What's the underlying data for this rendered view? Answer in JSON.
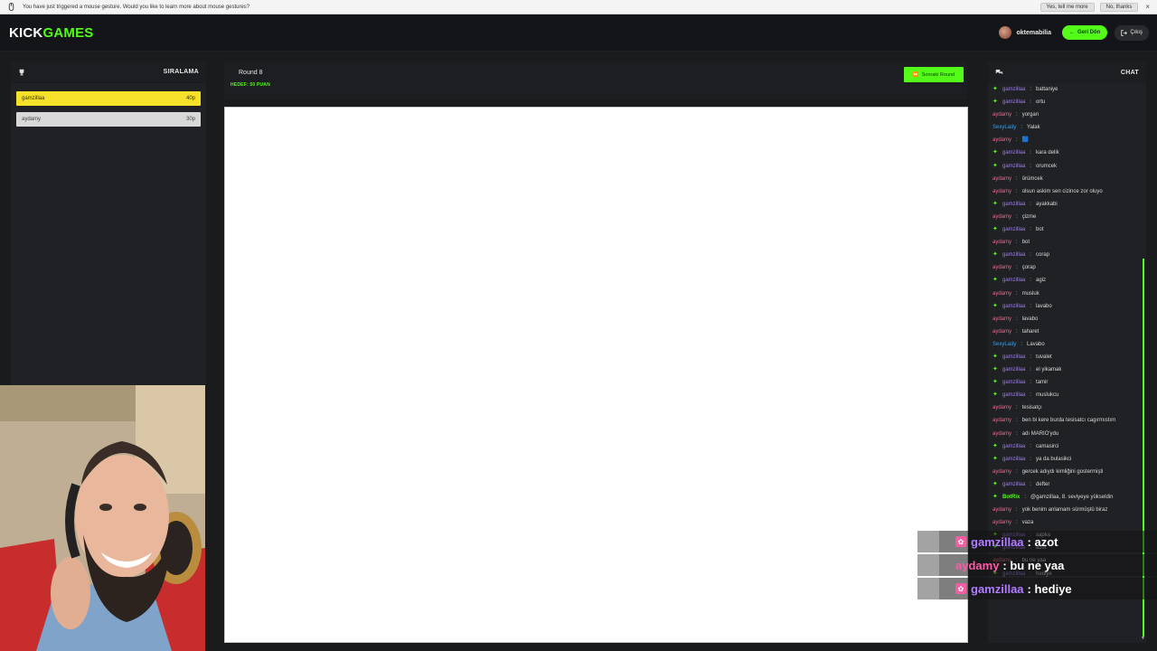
{
  "notification": {
    "text": "You have just triggered a mouse gesture. Would you like to learn more about mouse gestures?",
    "yes_label": "Yes, tell me more",
    "no_label": "No, thanks",
    "close": "×"
  },
  "header": {
    "logo_part1": "KICK",
    "logo_part2": "GAMES",
    "username": "oktemabilia",
    "back_label": "Geri Dön",
    "exit_label": "Çıkış"
  },
  "ranking": {
    "title": "SIRALAMA",
    "rows": [
      {
        "name": "gamzillaa",
        "points": "40p"
      },
      {
        "name": "aydamy",
        "points": "30p"
      }
    ]
  },
  "round": {
    "title": "Round 8",
    "goal": "HEDEF: 50 PUAN",
    "next_label": "Sonraki Round"
  },
  "chat": {
    "title": "CHAT",
    "messages": [
      {
        "user": "gamzillaa",
        "text": "battaniye",
        "type": "g"
      },
      {
        "user": "gamzillaa",
        "text": "ortu",
        "type": "g"
      },
      {
        "user": "aydamy",
        "text": "yorgan",
        "type": "a"
      },
      {
        "user": "SexyLady",
        "text": "Yalak",
        "type": "s"
      },
      {
        "user": "aydamy",
        "text": "🟦",
        "type": "a"
      },
      {
        "user": "gamzillaa",
        "text": "kara delik",
        "type": "g"
      },
      {
        "user": "gamzillaa",
        "text": "orumcek",
        "type": "g"
      },
      {
        "user": "aydamy",
        "text": "örümcek",
        "type": "a"
      },
      {
        "user": "aydamy",
        "text": "olsun askim sen cizince zor oluyo",
        "type": "a"
      },
      {
        "user": "gamzillaa",
        "text": "ayakkabi",
        "type": "g"
      },
      {
        "user": "aydamy",
        "text": "çizme",
        "type": "a"
      },
      {
        "user": "gamzillaa",
        "text": "bot",
        "type": "g"
      },
      {
        "user": "aydamy",
        "text": "bot",
        "type": "a"
      },
      {
        "user": "gamzillaa",
        "text": "corap",
        "type": "g"
      },
      {
        "user": "aydamy",
        "text": "çorap",
        "type": "a"
      },
      {
        "user": "gamzillaa",
        "text": "agiz",
        "type": "g"
      },
      {
        "user": "aydamy",
        "text": "musluk",
        "type": "a"
      },
      {
        "user": "gamzillaa",
        "text": "lavabo",
        "type": "g"
      },
      {
        "user": "aydamy",
        "text": "lavabo",
        "type": "a"
      },
      {
        "user": "aydamy",
        "text": "taharet",
        "type": "a"
      },
      {
        "user": "SexyLady",
        "text": "Lavabo",
        "type": "s"
      },
      {
        "user": "gamzillaa",
        "text": "tuvalet",
        "type": "g"
      },
      {
        "user": "gamzillaa",
        "text": "el yikamak",
        "type": "g"
      },
      {
        "user": "gamzillaa",
        "text": "tamir",
        "type": "g"
      },
      {
        "user": "gamzillaa",
        "text": "muslukcu",
        "type": "g"
      },
      {
        "user": "aydamy",
        "text": "tesisatçı",
        "type": "a"
      },
      {
        "user": "aydamy",
        "text": "ben bi kere burda tesisatcı cagırmıstım",
        "type": "a"
      },
      {
        "user": "aydamy",
        "text": "adı MARIO'ydu",
        "type": "a"
      },
      {
        "user": "gamzillaa",
        "text": "camasirci",
        "type": "g"
      },
      {
        "user": "gamzillaa",
        "text": "ya da bulasikci",
        "type": "g"
      },
      {
        "user": "aydamy",
        "text": "gercek adıydı kimliğini gostermişti",
        "type": "a"
      },
      {
        "user": "gamzillaa",
        "text": "defter",
        "type": "g"
      },
      {
        "user": "BotRix",
        "text": "@gamzillaa, 8. seviyeye yükseldin",
        "type": "b"
      },
      {
        "user": "aydamy",
        "text": "yok benim anlamam sürmüştü biraz",
        "type": "a"
      },
      {
        "user": "aydamy",
        "text": "vaza",
        "type": "a"
      },
      {
        "user": "gamzillaa",
        "text": "sapka",
        "type": "g"
      },
      {
        "user": "gamzillaa",
        "text": "azot",
        "type": "g"
      },
      {
        "user": "aydamy",
        "text": "bu ne yaa",
        "type": "a"
      },
      {
        "user": "gamzillaa",
        "text": "hediye",
        "type": "g"
      }
    ]
  },
  "overlay": [
    {
      "name": "gamzillaa",
      "text": ": azot",
      "type": "g"
    },
    {
      "name": "aydamy",
      "text": ": bu ne yaa",
      "type": "a"
    },
    {
      "name": "gamzillaa",
      "text": ": hediye",
      "type": "g"
    }
  ],
  "colors": {
    "accent": "#53fc18",
    "leader": "#f5e129",
    "background": "#1a1b1d"
  }
}
